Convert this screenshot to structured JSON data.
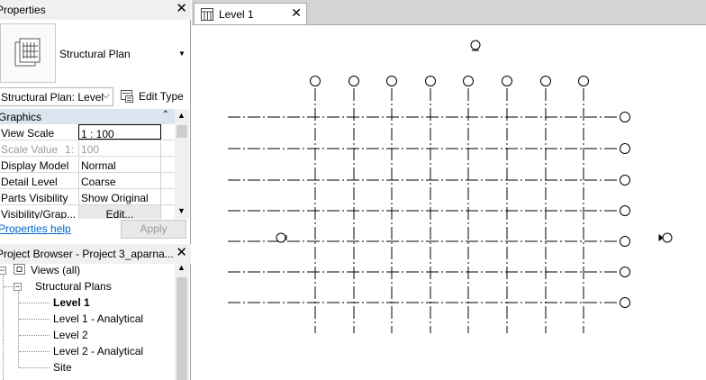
{
  "properties": {
    "title": "Properties",
    "type_name": "Structural Plan",
    "view_selector": "Structural Plan: Level",
    "edit_type_label": "Edit Type",
    "group": "Graphics",
    "rows": [
      {
        "name": "View Scale",
        "value": "1 : 100"
      },
      {
        "name": "Scale Value",
        "extra": "1:",
        "value": "100"
      },
      {
        "name": "Display Model",
        "value": "Normal"
      },
      {
        "name": "Detail Level",
        "value": "Coarse"
      },
      {
        "name": "Parts Visibility",
        "value": "Show Original"
      },
      {
        "name": "Visibility/Grap...",
        "value": "Edit..."
      }
    ],
    "help_link": "Properties help",
    "apply_label": "Apply"
  },
  "project_browser": {
    "title": "Project Browser - Project 3_aparna...",
    "views_root": "Views (all)",
    "category": "Structural Plans",
    "items": [
      "Level 1",
      "Level 1 - Analytical",
      "Level 2",
      "Level 2 - Analytical",
      "Site"
    ],
    "active_item": "Level 1"
  },
  "view_tab": {
    "label": "Level 1"
  },
  "colors": {
    "panel_header": "#f0f0f0",
    "group_row": "#dbe4ef",
    "tabbar": "#d4d4d4",
    "link": "#0066cc"
  }
}
